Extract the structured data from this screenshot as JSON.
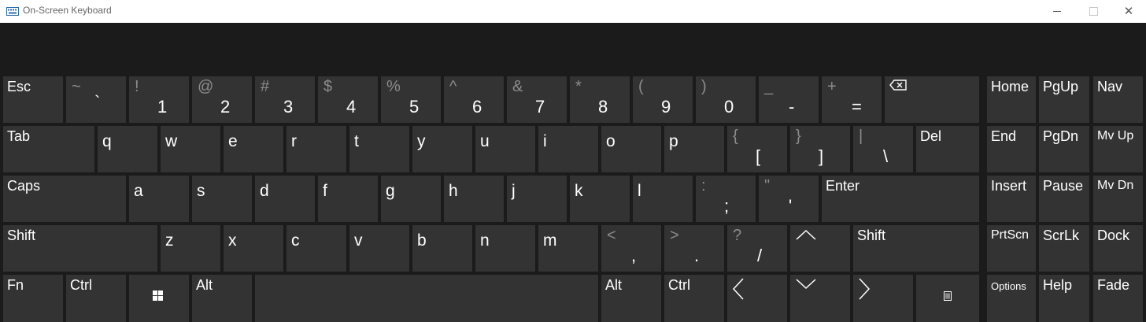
{
  "window": {
    "title": "On-Screen Keyboard",
    "icon": "keyboard-icon",
    "controls": {
      "minimize": "minimize-icon",
      "maximize": "maximize-icon",
      "close": "✕"
    }
  },
  "keys": {
    "esc": "Esc",
    "backtick": {
      "top": "~",
      "bottom": "`"
    },
    "n1": {
      "top": "!",
      "bottom": "1"
    },
    "n2": {
      "top": "@",
      "bottom": "2"
    },
    "n3": {
      "top": "#",
      "bottom": "3"
    },
    "n4": {
      "top": "$",
      "bottom": "4"
    },
    "n5": {
      "top": "%",
      "bottom": "5"
    },
    "n6": {
      "top": "^",
      "bottom": "6"
    },
    "n7": {
      "top": "&",
      "bottom": "7"
    },
    "n8": {
      "top": "*",
      "bottom": "8"
    },
    "n9": {
      "top": "(",
      "bottom": "9"
    },
    "n0": {
      "top": ")",
      "bottom": "0"
    },
    "minus": {
      "top": "_",
      "bottom": "-"
    },
    "equals": {
      "top": "+",
      "bottom": "="
    },
    "backspace": "backspace-icon",
    "tab": "Tab",
    "q": "q",
    "w": "w",
    "e": "e",
    "r": "r",
    "t": "t",
    "y": "y",
    "u": "u",
    "i": "i",
    "o": "o",
    "p": "p",
    "lbracket": {
      "top": "{",
      "bottom": "["
    },
    "rbracket": {
      "top": "}",
      "bottom": "]"
    },
    "backslash": {
      "top": "|",
      "bottom": "\\"
    },
    "del": "Del",
    "caps": "Caps",
    "a": "a",
    "s": "s",
    "d": "d",
    "f": "f",
    "g": "g",
    "h": "h",
    "j": "j",
    "k": "k",
    "l": "l",
    "semicolon": {
      "top": ":",
      "bottom": ";"
    },
    "quote": {
      "top": "\"",
      "bottom": "'"
    },
    "enter": "Enter",
    "shift_left": "Shift",
    "z": "z",
    "x": "x",
    "c": "c",
    "v": "v",
    "b": "b",
    "n": "n",
    "m": "m",
    "comma": {
      "top": "<",
      "bottom": ","
    },
    "period": {
      "top": ">",
      "bottom": "."
    },
    "slash": {
      "top": "?",
      "bottom": "/"
    },
    "up": "arrow-up-icon",
    "shift_right": "Shift",
    "fn": "Fn",
    "ctrl_left": "Ctrl",
    "win": "windows-logo-icon",
    "alt_left": "Alt",
    "space": "",
    "alt_right": "Alt",
    "ctrl_right": "Ctrl",
    "left": "arrow-left-icon",
    "down": "arrow-down-icon",
    "right": "arrow-right-icon",
    "menu": "context-menu-icon"
  },
  "side_keys": {
    "home": "Home",
    "pgup": "PgUp",
    "nav": "Nav",
    "end": "End",
    "pgdn": "PgDn",
    "mvup": "Mv Up",
    "insert": "Insert",
    "pause": "Pause",
    "mvdn": "Mv Dn",
    "prtscn": "PrtScn",
    "scrlk": "ScrLk",
    "dock": "Dock",
    "options": "Options",
    "help": "Help",
    "fade": "Fade"
  }
}
